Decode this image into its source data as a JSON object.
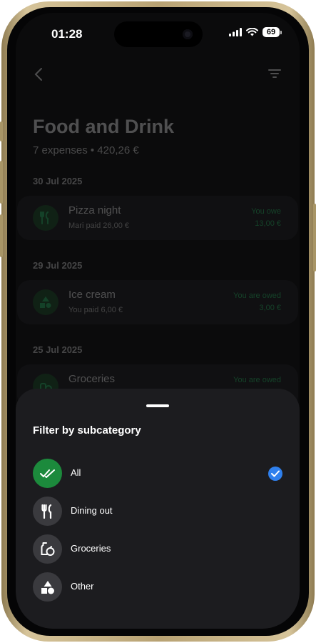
{
  "status_bar": {
    "time": "01:28",
    "battery": "69"
  },
  "page": {
    "title": "Food and Drink",
    "subtitle": "7 expenses • 420,26 €"
  },
  "expenses": [
    {
      "date": "30 Jul 2025",
      "name": "Pizza night",
      "paid": "Mari paid 26,00 €",
      "status": "You owe",
      "amount": "13,00 €",
      "icon": "fork-knife-icon"
    },
    {
      "date": "29 Jul 2025",
      "name": "Ice cream",
      "paid": "You paid 6,00 €",
      "status": "You are owed",
      "amount": "3,00 €",
      "icon": "shapes-icon"
    },
    {
      "date": "25 Jul 2025",
      "name": "Groceries",
      "paid": "",
      "status": "You are owed",
      "amount": "",
      "icon": "groceries-icon"
    }
  ],
  "sheet": {
    "title": "Filter by subcategory",
    "options": [
      {
        "label": "All",
        "icon": "double-check-icon",
        "selected": true
      },
      {
        "label": "Dining out",
        "icon": "fork-knife-icon",
        "selected": false
      },
      {
        "label": "Groceries",
        "icon": "groceries-icon",
        "selected": false
      },
      {
        "label": "Other",
        "icon": "shapes-icon",
        "selected": false
      }
    ]
  },
  "colors": {
    "accent_green": "#1c8a3c",
    "check_blue": "#2f80ed",
    "sheet_bg": "#1c1c1f"
  }
}
